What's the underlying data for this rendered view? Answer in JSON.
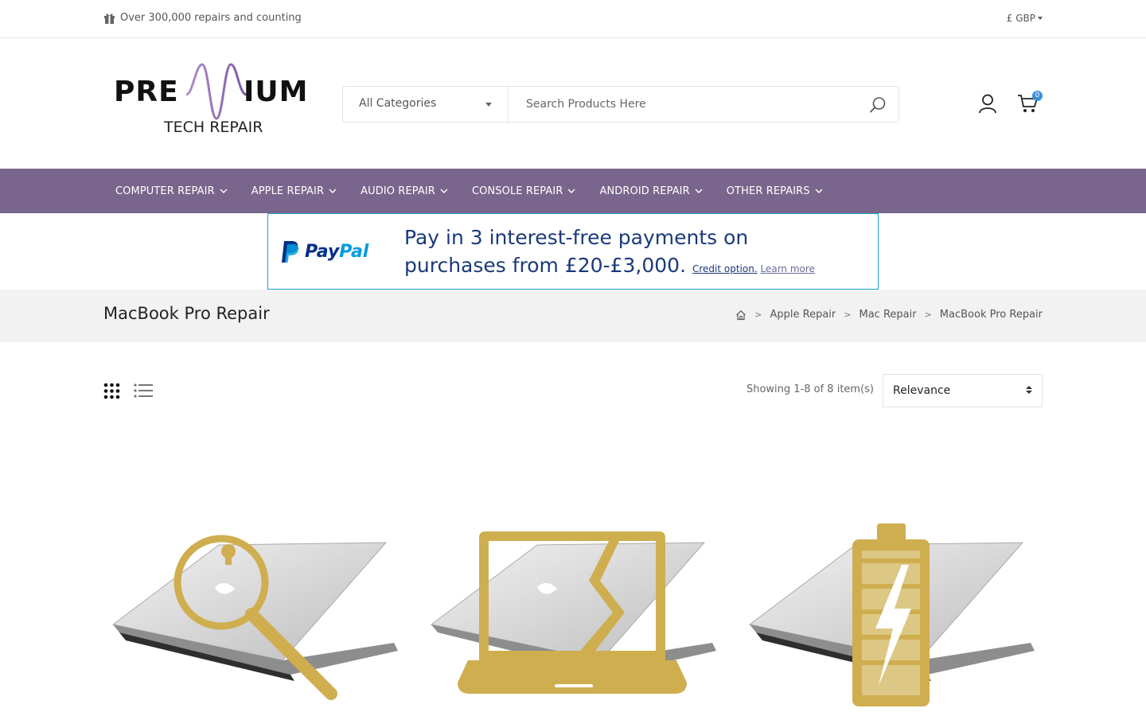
{
  "topbar": {
    "promo_text": "Over 300,000 repairs and counting",
    "currency": "£ GBP"
  },
  "logo": {
    "word_left": "PRE",
    "word_right": "IUM",
    "subtitle": "TECH REPAIR"
  },
  "search": {
    "category": "All Categories",
    "placeholder": "Search Products Here"
  },
  "cart": {
    "count": "0"
  },
  "nav": {
    "items": [
      {
        "label": "COMPUTER REPAIR"
      },
      {
        "label": "APPLE REPAIR"
      },
      {
        "label": "AUDIO REPAIR"
      },
      {
        "label": "CONSOLE REPAIR"
      },
      {
        "label": "ANDROID REPAIR"
      },
      {
        "label": "OTHER REPAIRS"
      }
    ]
  },
  "paypal": {
    "brand_pay": "Pay",
    "brand_pal": "Pal",
    "message_line1": "Pay in 3 interest-free payments on",
    "message_line2": "purchases from £20-£3,000.",
    "credit_label": "Credit option.",
    "learn_more": "Learn more"
  },
  "page": {
    "title": "MacBook Pro Repair",
    "breadcrumbs": [
      "Apple Repair",
      "Mac Repair",
      "MacBook Pro Repair"
    ]
  },
  "toolbar": {
    "showing": "Showing 1-8 of 8 item(s)",
    "sort_selected": "Relevance"
  },
  "products": [
    {
      "icon": "magnifier-icon"
    },
    {
      "icon": "cracked-screen-icon"
    },
    {
      "icon": "battery-icon"
    }
  ],
  "colors": {
    "nav_bg": "#7a668c",
    "gold": "#cfae50",
    "paypal_blue": "#003087",
    "paypal_light": "#009cde",
    "badge": "#3b8fd9"
  }
}
